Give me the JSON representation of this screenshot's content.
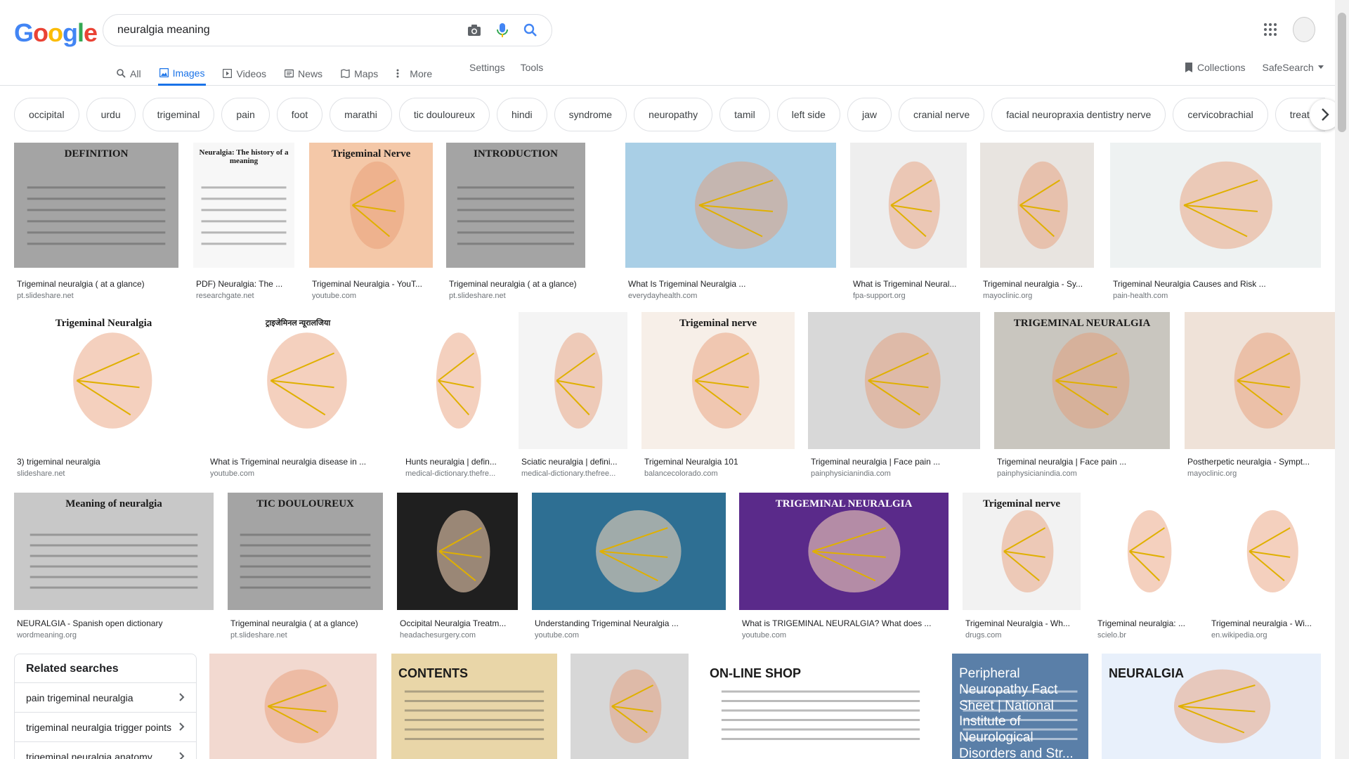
{
  "logo_letters": [
    {
      "ch": "G",
      "color": "#4285F4"
    },
    {
      "ch": "o",
      "color": "#EA4335"
    },
    {
      "ch": "o",
      "color": "#FBBC05"
    },
    {
      "ch": "g",
      "color": "#4285F4"
    },
    {
      "ch": "l",
      "color": "#34A853"
    },
    {
      "ch": "e",
      "color": "#EA4335"
    }
  ],
  "search": {
    "value": "neuralgia meaning"
  },
  "tabs": [
    {
      "label": "All",
      "icon": "search-icon",
      "active": false
    },
    {
      "label": "Images",
      "icon": "image-icon",
      "active": true
    },
    {
      "label": "Videos",
      "icon": "video-icon",
      "active": false
    },
    {
      "label": "News",
      "icon": "news-icon",
      "active": false
    },
    {
      "label": "Maps",
      "icon": "map-icon",
      "active": false
    },
    {
      "label": "More",
      "icon": "more-dots-icon",
      "active": false
    }
  ],
  "tools": {
    "settings": "Settings",
    "tools": "Tools",
    "collections": "Collections",
    "safesearch": "SafeSearch"
  },
  "chips": [
    "occipital",
    "urdu",
    "trigeminal",
    "pain",
    "foot",
    "marathi",
    "tic douloureux",
    "hindi",
    "syndrome",
    "neuropathy",
    "tamil",
    "left side",
    "jaw",
    "cranial nerve",
    "facial neuropraxia dentistry nerve",
    "cervicobrachial",
    "treatment"
  ],
  "row1": [
    {
      "caption": "Trigeminal neuralgia ( at a glance)",
      "source": "pt.slideshare.net",
      "bg": "#a4a4a4",
      "label": "DEFINITION"
    },
    {
      "caption": "PDF) Neuralgia: The ...",
      "source": "researchgate.net",
      "bg": "#f7f7f7",
      "label": "Neuralgia: The history of a meaning"
    },
    {
      "caption": "Trigeminal Neuralgia - YouT...",
      "source": "youtube.com",
      "bg": "#f4c8a8",
      "label": "Trigeminal Nerve"
    },
    {
      "caption": "Trigeminal neuralgia ( at a glance)",
      "source": "pt.slideshare.net",
      "bg": "#a4a4a4",
      "label": "INTRODUCTION"
    },
    {
      "caption": "What Is Trigeminal Neuralgia ...",
      "source": "everydayhealth.com",
      "bg": "#a9cfe6",
      "label": ""
    },
    {
      "caption": "What is Trigeminal Neural...",
      "source": "fpa-support.org",
      "bg": "#eeeeee",
      "label": ""
    },
    {
      "caption": "Trigeminal neuralgia - Sy...",
      "source": "mayoclinic.org",
      "bg": "#e8e4e0",
      "label": ""
    },
    {
      "caption": "Trigeminal Neuralgia Causes and Risk ...",
      "source": "pain-health.com",
      "bg": "#eef2f2",
      "label": ""
    }
  ],
  "row2": [
    {
      "caption": "3) trigeminal neuralgia",
      "source": "slideshare.net",
      "bg": "#ffffff",
      "label": "Trigeminal Neuralgia"
    },
    {
      "caption": "What is Trigeminal neuralgia disease in ...",
      "source": "youtube.com",
      "bg": "#ffffff",
      "label": "ट्राइजेमिनल न्यूरालजिया"
    },
    {
      "caption": "Hunts neuralgia | defin...",
      "source": "medical-dictionary.thefre...",
      "bg": "#ffffff",
      "label": ""
    },
    {
      "caption": "Sciatic neuralgia | defini...",
      "source": "medical-dictionary.thefree...",
      "bg": "#f4f4f4",
      "label": ""
    },
    {
      "caption": "Trigeminal Neuralgia 101",
      "source": "balancecolorado.com",
      "bg": "#f7efe8",
      "label": "Trigeminal nerve"
    },
    {
      "caption": "Trigeminal neuralgia | Face pain ...",
      "source": "painphysicianindia.com",
      "bg": "#d8d8d8",
      "label": ""
    },
    {
      "caption": "Trigeminal neuralgia | Face pain ...",
      "source": "painphysicianindia.com",
      "bg": "#c9c6bf",
      "label": "TRIGEMINAL NEURALGIA"
    },
    {
      "caption": "Postherpetic neuralgia - Sympt...",
      "source": "mayoclinic.org",
      "bg": "#efe2d8",
      "label": ""
    }
  ],
  "row3": [
    {
      "caption": "NEURALGIA - Spanish open dictionary",
      "source": "wordmeaning.org",
      "bg": "#c8c8c8",
      "label": "Meaning of neuralgia"
    },
    {
      "caption": "Trigeminal neuralgia ( at a glance)",
      "source": "pt.slideshare.net",
      "bg": "#a4a4a4",
      "label": "TIC DOULOUREUX"
    },
    {
      "caption": "Occipital Neuralgia Treatm...",
      "source": "headachesurgery.com",
      "bg": "#1f1f1f",
      "label": ""
    },
    {
      "caption": "Understanding Trigeminal Neuralgia ...",
      "source": "youtube.com",
      "bg": "#2e6f93",
      "label": ""
    },
    {
      "caption": "What is TRIGEMINAL NEURALGIA? What does ...",
      "source": "youtube.com",
      "bg": "#5a2a8a",
      "label": "TRIGEMINAL NEURALGIA"
    },
    {
      "caption": "Trigeminal Neuralgia - Wh...",
      "source": "drugs.com",
      "bg": "#f2f2f2",
      "label": "Trigeminal nerve"
    },
    {
      "caption": "Trigeminal neuralgia: ...",
      "source": "scielo.br",
      "bg": "#ffffff",
      "label": ""
    },
    {
      "caption": "Trigeminal neuralgia - Wi...",
      "source": "en.wikipedia.org",
      "bg": "#ffffff",
      "label": ""
    }
  ],
  "related": {
    "title": "Related searches",
    "items": [
      "pain trigeminal neuralgia",
      "trigeminal neuralgia trigger points",
      "trigeminal neuralgia anatomy"
    ]
  },
  "row4": [
    {
      "bg": "#f2d9d0",
      "label": ""
    },
    {
      "bg": "#e9d6a8",
      "label": "CONTENTS"
    },
    {
      "bg": "#d7d7d7",
      "label": ""
    },
    {
      "bg": "#ffffff",
      "label": "ON-LINE SHOP"
    },
    {
      "bg": "#5a7fa8",
      "label": "Peripheral Neuropathy Fact Sheet | National Institute of Neurological Disorders and Str..."
    },
    {
      "bg": "#e8f0fb",
      "label": "NEURALGIA"
    }
  ]
}
